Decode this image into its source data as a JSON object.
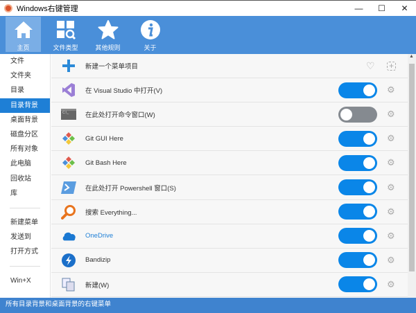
{
  "window": {
    "title": "Windows右键管理",
    "buttons": [
      "minimize",
      "maximize",
      "close"
    ]
  },
  "toolbar": {
    "tabs": [
      {
        "label": "主页",
        "icon": "home-icon"
      },
      {
        "label": "文件类型",
        "icon": "file-types-icon"
      },
      {
        "label": "其他规则",
        "icon": "star-icon"
      },
      {
        "label": "关于",
        "icon": "info-icon"
      }
    ]
  },
  "sidebar": {
    "items": [
      "文件",
      "文件夹",
      "目录",
      "目录背景",
      "桌面背景",
      "磁盘分区",
      "所有对象",
      "此电脑",
      "回收站",
      "库"
    ],
    "items2": [
      "新建菜单",
      "发送到",
      "打开方式"
    ],
    "items3": [
      "Win+X"
    ],
    "selected": "目录背景"
  },
  "content": {
    "new_item": "新建一个菜单项目",
    "rows": [
      {
        "label": "在 Visual Studio 中打开(V)",
        "enabled": true
      },
      {
        "label": "在此处打开命令窗口(W)",
        "enabled": false
      },
      {
        "label": "Git GUI Here",
        "enabled": true
      },
      {
        "label": "Git Bash Here",
        "enabled": true
      },
      {
        "label": "在此处打开 Powershell 窗口(S)",
        "enabled": true
      },
      {
        "label": "搜索 Everything...",
        "enabled": true
      },
      {
        "label": "OneDrive",
        "enabled": true
      },
      {
        "label": "Bandizip",
        "enabled": true
      },
      {
        "label": "新建(W)",
        "enabled": true
      }
    ]
  },
  "colors": {
    "toolbar": "#4a8fd9",
    "accent": "#1e7fd6",
    "toggle_on": "#0a86e8",
    "toggle_off": "#858a90",
    "onedrive_text": "#1e7fd6"
  },
  "status": "所有目录背景和桌面背景的右键菜单"
}
